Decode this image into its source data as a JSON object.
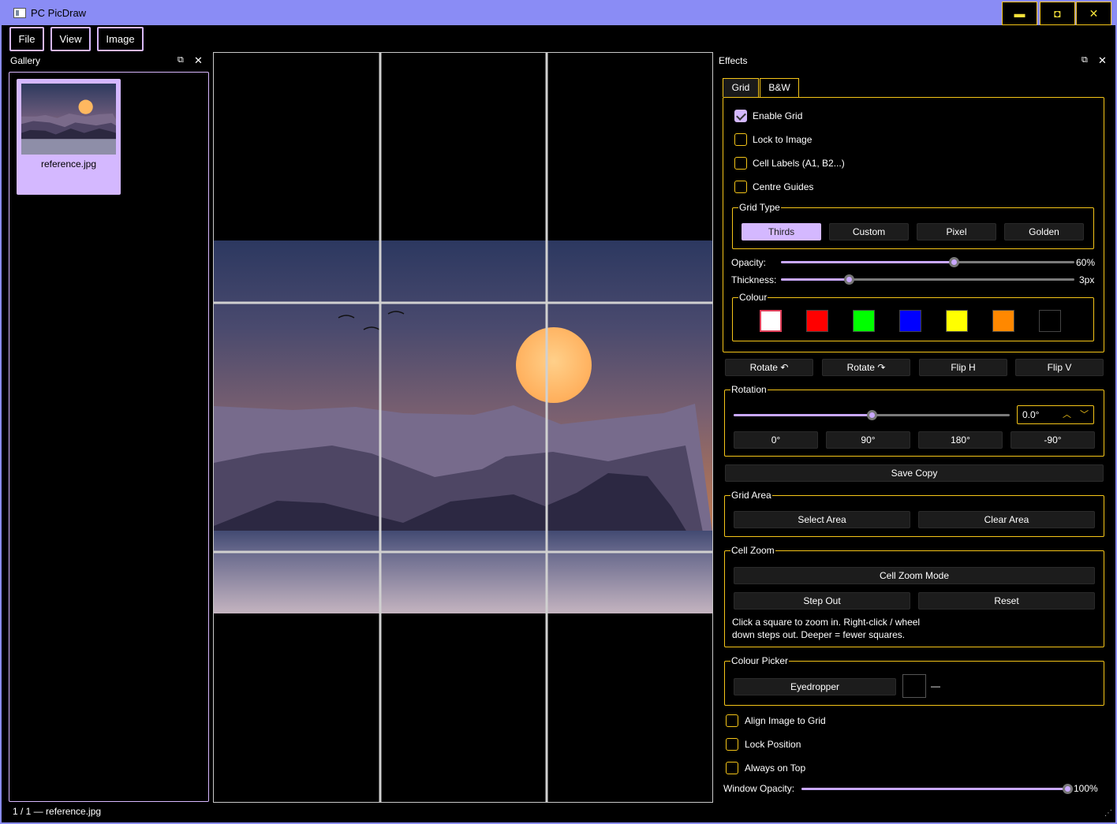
{
  "window": {
    "title": "PC PicDraw",
    "controls": {
      "minimize": "▬",
      "maximize": "◘",
      "close": "✕"
    }
  },
  "menu": {
    "file": "File",
    "view": "View",
    "image": "Image"
  },
  "gallery": {
    "title": "Gallery",
    "items": [
      {
        "label": "reference.jpg"
      }
    ]
  },
  "status": {
    "text": "1 / 1  —  reference.jpg"
  },
  "effects": {
    "title": "Effects",
    "tabs": [
      "Grid",
      "B&W"
    ],
    "active_tab": "Grid",
    "grid": {
      "enable_grid": {
        "label": "Enable Grid",
        "checked": true
      },
      "lock_to_image": {
        "label": "Lock to Image",
        "checked": false
      },
      "cell_labels": {
        "label": "Cell Labels (A1, B2...)",
        "checked": false
      },
      "centre_guides": {
        "label": "Centre Guides",
        "checked": false
      },
      "grid_type": {
        "title": "Grid Type",
        "options": [
          "Thirds",
          "Custom",
          "Pixel",
          "Golden"
        ],
        "selected": "Thirds"
      },
      "opacity": {
        "label": "Opacity:",
        "value": 60,
        "display": "60%"
      },
      "thickness": {
        "label": "Thickness:",
        "value": 3,
        "display": "3px"
      },
      "colour": {
        "title": "Colour",
        "swatches": [
          "#ffffff",
          "#ff0000",
          "#00ff00",
          "#0000ff",
          "#ffff00",
          "#ff8800",
          "#000000"
        ],
        "selected_index": 0
      }
    },
    "transform_buttons": {
      "rotate_left": "Rotate ↶",
      "rotate_right": "Rotate ↷",
      "flip_h": "Flip H",
      "flip_v": "Flip V"
    },
    "rotation": {
      "title": "Rotation",
      "value": "0.0°",
      "slider_fraction": 0.5,
      "presets": [
        "0°",
        "90°",
        "180°",
        "-90°"
      ]
    },
    "save_copy": "Save Copy",
    "grid_area": {
      "title": "Grid Area",
      "select": "Select Area",
      "clear": "Clear Area"
    },
    "cell_zoom": {
      "title": "Cell Zoom",
      "mode": "Cell Zoom Mode",
      "step_out": "Step Out",
      "reset": "Reset",
      "note_line1": "Click a square to zoom in. Right-click / wheel",
      "note_line2": "down steps out. Deeper = fewer squares."
    },
    "colour_picker": {
      "title": "Colour Picker",
      "eyedropper": "Eyedropper",
      "value": "—"
    },
    "align_image": {
      "label": "Align Image to Grid",
      "checked": false
    },
    "lock_position": {
      "label": "Lock Position",
      "checked": false
    },
    "always_on_top": {
      "label": "Always on Top",
      "checked": false
    },
    "window_opacity": {
      "label": "Window Opacity:",
      "value": 100,
      "display": "100%"
    }
  },
  "colors": {
    "accent": "#d4b8ff",
    "border_yellow": "#f5c518",
    "titlebar": "#8a8cf5"
  }
}
